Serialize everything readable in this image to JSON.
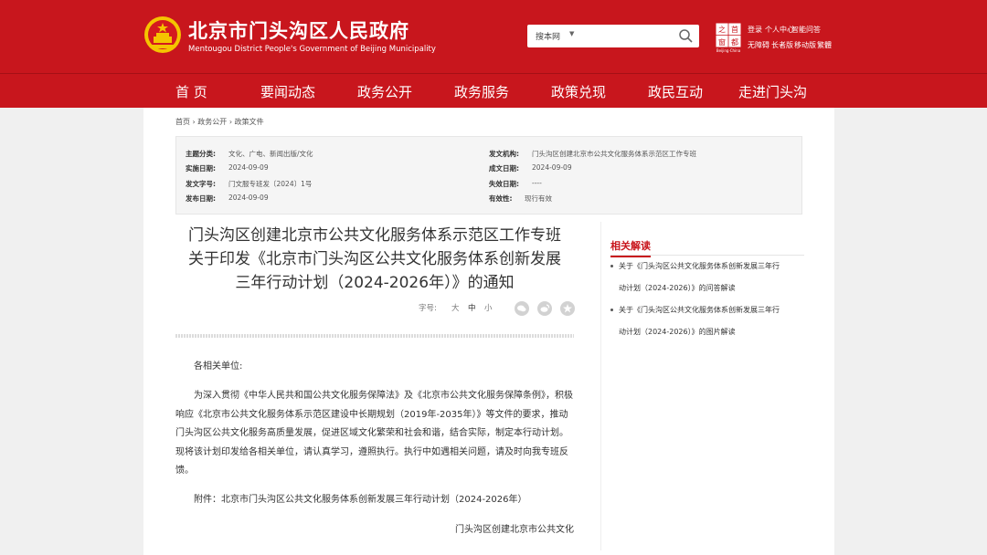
{
  "header": {
    "title": "北京市门头沟区人民政府",
    "subtitle": "Mentougou District People's Government of Beijing Municipality",
    "search_scope": "搜本网",
    "search_placeholder": "",
    "logo_text": "首都之窗",
    "logo_sub": "Beijing·China",
    "links_row1": [
      "登录",
      "个人中心",
      "智能问答"
    ],
    "links_row2": [
      "无障碍",
      "长者版",
      "移动版",
      "繁體"
    ]
  },
  "nav": {
    "items": [
      "首 页",
      "要闻动态",
      "政务公开",
      "政务服务",
      "政策兑现",
      "政民互动",
      "走进门头沟"
    ]
  },
  "breadcrumb": {
    "items": [
      "首页",
      "政务公开",
      "政策文件"
    ],
    "sep": "›"
  },
  "meta": {
    "left": [
      {
        "key": "主题分类:",
        "value": "文化、广电、新闻出版/文化"
      },
      {
        "key": "实施日期:",
        "value": "2024-09-09"
      },
      {
        "key": "发文字号:",
        "value": "门文服专班发〔2024〕1号"
      },
      {
        "key": "发布日期:",
        "value": "2024-09-09"
      }
    ],
    "right": [
      {
        "key": "发文机构:",
        "value": "门头沟区创建北京市公共文化服务体系示范区工作专班"
      },
      {
        "key": "成文日期:",
        "value": "2024-09-09"
      },
      {
        "key": "失效日期:",
        "value": "----"
      },
      {
        "key": "有效性:",
        "value": "现行有效"
      }
    ]
  },
  "doc": {
    "title_lines": [
      "门头沟区创建北京市公共文化服务体系示范区工作专班",
      "关于印发《北京市门头沟区公共文化服务体系创新发展",
      "三年行动计划（2024-2026年）》的通知"
    ],
    "font_label": "字号:",
    "font_sizes": [
      "大",
      "中",
      "小"
    ],
    "share_icons": [
      "wechat-icon",
      "weibo-icon",
      "star-icon"
    ],
    "salutation": "各相关单位:",
    "body": "为深入贯彻《中华人民共和国公共文化服务保障法》及《北京市公共文化服务保障条例》，积极响应《北京市公共文化服务体系示范区建设中长期规划（2019年-2035年）》等文件的要求，推动门头沟区公共文化服务高质量发展，促进区域文化繁荣和社会和谐，结合实际，制定本行动计划。现将该计划印发给各相关单位，请认真学习，遵照执行。执行中如遇相关问题，请及时向我专班反馈。",
    "attachment": "附件：北京市门头沟区公共文化服务体系创新发展三年行动计划（2024-2026年）",
    "signature": "门头沟区创建北京市公共文化"
  },
  "sidebar": {
    "title": "相关解读",
    "links": [
      [
        "关于《门头沟区公共文化服务体系创新发展三年行",
        "动计划（2024-2026）》的问答解读"
      ],
      [
        "关于《门头沟区公共文化服务体系创新发展三年行",
        "动计划（2024-2026）》的图片解读"
      ]
    ]
  },
  "colors": {
    "brand_red": "#c8161d",
    "emblem_gold": "#f5c400"
  }
}
